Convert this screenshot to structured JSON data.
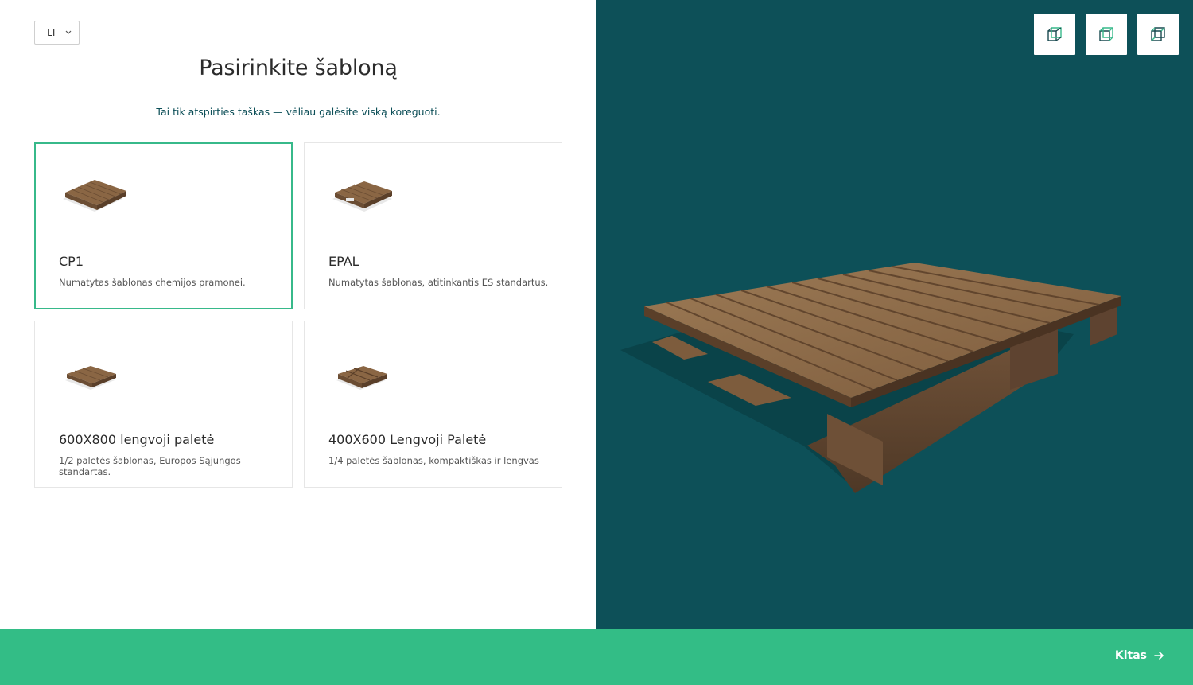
{
  "language": {
    "selected": "LT",
    "icon": "chevron-down-icon"
  },
  "header": {
    "title": "Pasirinkite šabloną",
    "subtitle": "Tai tik atspirties taškas — vėliau galėsite viską koreguoti."
  },
  "templates": [
    {
      "title": "CP1",
      "description": "Numatytas šablonas chemijos pramonei.",
      "selected": true
    },
    {
      "title": "EPAL",
      "description": "Numatytas šablonas, atitinkantis ES standartus.",
      "selected": false
    },
    {
      "title": "600X800 lengvoji paletė",
      "description": "1/2 paletės šablonas, Europos Sąjungos standartas.",
      "selected": false
    },
    {
      "title": "400X600 Lengvoji Paletė",
      "description": "1/4 paletės šablonas, kompaktiškas ir lengvas",
      "selected": false
    }
  ],
  "view_controls": [
    {
      "icon": "cube-perspective-icon"
    },
    {
      "icon": "cube-front-icon"
    },
    {
      "icon": "cube-side-icon"
    }
  ],
  "footer": {
    "next_label": "Kitas",
    "next_icon": "arrow-right-icon"
  },
  "colors": {
    "accent_green": "#33bd86",
    "viewer_background": "#0d5058",
    "selected_border": "#37b98a",
    "wood": "#8a6644"
  }
}
